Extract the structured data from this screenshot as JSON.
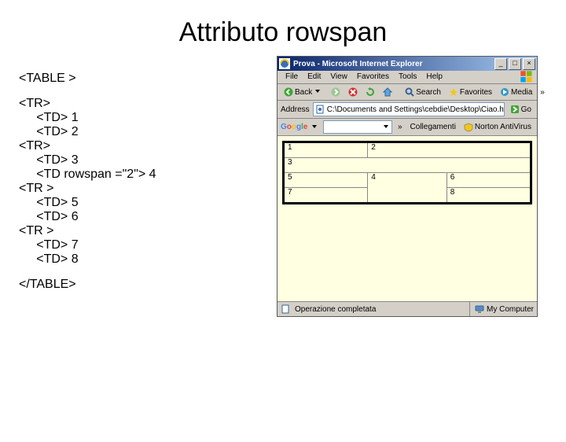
{
  "title": "Attributo rowspan",
  "code": {
    "l0": "<TABLE >",
    "l1": "<TR>",
    "l2": "     <TD> 1",
    "l3": "     <TD> 2",
    "l4": "<TR>",
    "l5": "     <TD> 3",
    "l6": "     <TD rowspan =\"2\"> 4",
    "l7": "<TR >",
    "l8": "     <TD> 5",
    "l9": "     <TD> 6",
    "l10": "<TR >",
    "l11": "     <TD> 7",
    "l12": "     <TD> 8",
    "l13": "</TABLE>"
  },
  "browser": {
    "window_title": "Prova - Microsoft Internet Explorer",
    "menu": {
      "file": "File",
      "edit": "Edit",
      "view": "View",
      "favorites": "Favorites",
      "tools": "Tools",
      "help": "Help"
    },
    "toolbar": {
      "back": "Back",
      "search": "Search",
      "favorites": "Favorites",
      "media": "Media",
      "overflow": "»"
    },
    "address": {
      "label": "Address",
      "value": "C:\\Documents and Settings\\cebdie\\Desktop\\Ciao.htm",
      "go": "Go"
    },
    "googlebar": {
      "brand": "Google",
      "overflow": "»",
      "item1": "Collegamenti",
      "item2": "Norton AntiVirus"
    },
    "status": {
      "text": "Operazione completata",
      "zone": "My Computer"
    },
    "table": {
      "r0c0": "1",
      "r0c1": "2",
      "r1c0": "3",
      "r2c0": "5",
      "r2c1": "4",
      "r2c2": "6",
      "r3c0": "7",
      "r3c1": "8"
    }
  }
}
